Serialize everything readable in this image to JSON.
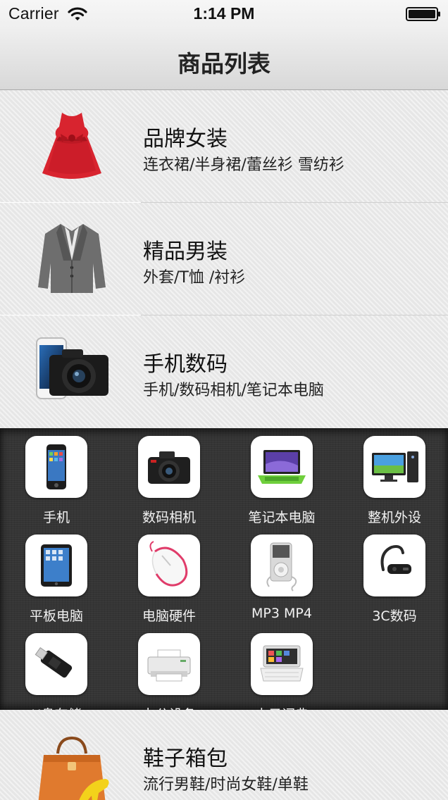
{
  "status_bar": {
    "carrier": "Carrier",
    "time": "1:14 PM"
  },
  "nav": {
    "title": "商品列表"
  },
  "categories": [
    {
      "title": "品牌女装",
      "subtitle": "连衣裙/半身裙/蕾丝衫 雪纺衫",
      "icon": "red-dress-icon"
    },
    {
      "title": "精品男装",
      "subtitle": "外套/T恤 /衬衫",
      "icon": "blazer-icon"
    },
    {
      "title": "手机数码",
      "subtitle": "手机/数码相机/笔记本电脑",
      "icon": "phone-camera-icon"
    },
    {
      "title": "鞋子箱包",
      "subtitle": "流行男鞋/时尚女鞋/单鞋",
      "icon": "handbag-heel-icon"
    }
  ],
  "subcategories": [
    {
      "label": "手机",
      "icon": "mobile-phone-icon"
    },
    {
      "label": "数码相机",
      "icon": "digital-camera-icon"
    },
    {
      "label": "笔记本电脑",
      "icon": "laptop-icon"
    },
    {
      "label": "整机外设",
      "icon": "desktop-pc-icon"
    },
    {
      "label": "平板电脑",
      "icon": "tablet-icon"
    },
    {
      "label": "电脑硬件",
      "icon": "mouse-icon"
    },
    {
      "label": "MP3 MP4",
      "icon": "mp3-player-icon"
    },
    {
      "label": "3C数码",
      "icon": "bluetooth-headset-icon"
    },
    {
      "label": "U盘存储",
      "icon": "usb-drive-icon"
    },
    {
      "label": "办公设备",
      "icon": "printer-icon"
    },
    {
      "label": "电子词典",
      "icon": "electronic-dictionary-icon"
    }
  ]
}
